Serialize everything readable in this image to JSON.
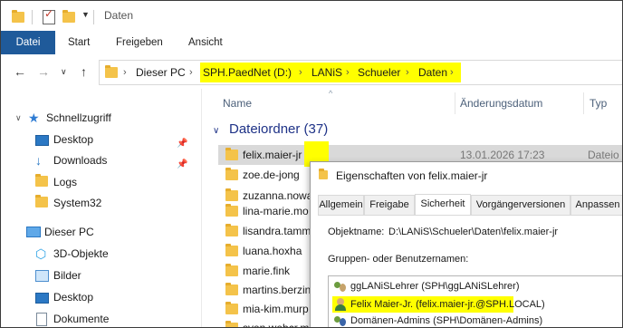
{
  "window": {
    "title": "Daten"
  },
  "ribbon": {
    "tabs": [
      "Datei",
      "Start",
      "Freigeben",
      "Ansicht"
    ]
  },
  "address": {
    "crumbs": [
      "Dieser PC",
      "SPH.PaedNet (D:)",
      "LANiS",
      "Schueler",
      "Daten"
    ]
  },
  "sidebar": {
    "quick_access": "Schnellzugriff",
    "items": [
      {
        "label": "Desktop",
        "icon": "desktop-icon",
        "pinned": true
      },
      {
        "label": "Downloads",
        "icon": "downloads-icon",
        "pinned": true
      },
      {
        "label": "Logs",
        "icon": "folder-icon",
        "pinned": false
      },
      {
        "label": "System32",
        "icon": "folder-icon",
        "pinned": false
      }
    ],
    "this_pc": "Dieser PC",
    "pc_items": [
      {
        "label": "3D-Objekte",
        "icon": "3d-objects-icon"
      },
      {
        "label": "Bilder",
        "icon": "pictures-icon"
      },
      {
        "label": "Desktop",
        "icon": "desktop-icon"
      },
      {
        "label": "Dokumente",
        "icon": "documents-icon"
      }
    ]
  },
  "columns": {
    "name": "Name",
    "date": "Änderungsdatum",
    "type": "Typ"
  },
  "group": {
    "label": "Dateiordner (37)"
  },
  "files": [
    {
      "name": "felix.maier-jr",
      "date": "13.01.2026 17:23",
      "type": "Dateio"
    },
    {
      "name": "zoe.de-jong",
      "date": "",
      "type": ""
    },
    {
      "name": "zuzanna.nowa",
      "date": "",
      "type": ""
    },
    {
      "name": "lina-marie.mo",
      "date": "",
      "type": ""
    },
    {
      "name": "lisandra.tamm",
      "date": "",
      "type": ""
    },
    {
      "name": "luana.hoxha",
      "date": "",
      "type": ""
    },
    {
      "name": "marie.fink",
      "date": "",
      "type": ""
    },
    {
      "name": "martins.berzin",
      "date": "",
      "type": ""
    },
    {
      "name": "mia-kim.murp",
      "date": "",
      "type": ""
    },
    {
      "name": "sven.webcr.m",
      "date": "",
      "type": ""
    }
  ],
  "dialog": {
    "title": "Eigenschaften von felix.maier-jr",
    "tabs": [
      "Allgemein",
      "Freigabe",
      "Sicherheit",
      "Vorgängerversionen",
      "Anpassen"
    ],
    "active_tab": "Sicherheit",
    "object_label": "Objektname:",
    "object_value": "D:\\LANiS\\Schueler\\Daten\\felix.maier-jr",
    "group_label": "Gruppen- oder Benutzernamen:",
    "principals": [
      "ggLANiSLehrer (SPH\\ggLANiSLehrer)",
      "Felix Maier-Jr. (felix.maier-jr.@SPH.LOCAL)",
      "Domänen-Admins (SPH\\Domänen-Admins)"
    ]
  },
  "colors": {
    "accent": "#1f5a9a",
    "highlight": "#ffff00",
    "folder": "#f4c34a"
  }
}
